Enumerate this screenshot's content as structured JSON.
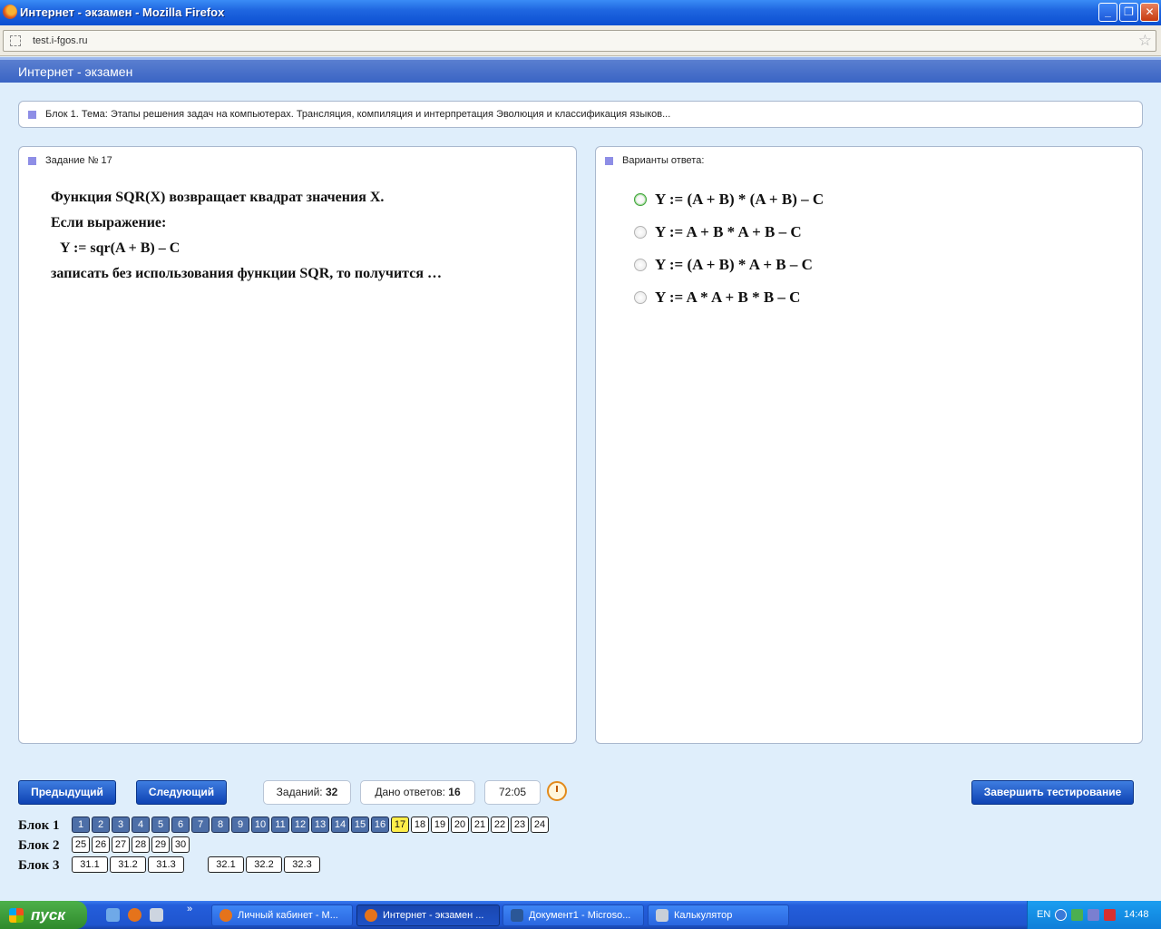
{
  "window": {
    "title": "Интернет - экзамен - Mozilla Firefox",
    "url": "test.i-fgos.ru"
  },
  "app": {
    "header_title": "Интернет - экзамен"
  },
  "block_info": "Блок 1. Тема: Этапы решения задач на компьютерах. Трансляция, компиляция и интерпретация Эволюция и классификация языков...",
  "task": {
    "header": "Задание № 17",
    "lines": [
      "Функция SQR(X) возвращает квадрат значения X.",
      "Если выражение:",
      "Y := sqr(A + B) – C",
      "записать без использования функции SQR, то получится …"
    ]
  },
  "answers": {
    "header": "Варианты ответа:",
    "options": [
      "Y := (A + B) * (A + B) – C",
      "Y := A + B * A + B – C",
      "Y := (A + B) * A + B – C",
      "Y := A * A + B * B – C"
    ]
  },
  "controls": {
    "prev": "Предыдущий",
    "next": "Следующий",
    "tasks_label": "Заданий:",
    "tasks_value": "32",
    "answered_label": "Дано ответов:",
    "answered_value": "16",
    "timer": "72:05",
    "finish": "Завершить тестирование"
  },
  "blocks": [
    {
      "label": "Блок 1",
      "items": [
        "1",
        "2",
        "3",
        "4",
        "5",
        "6",
        "7",
        "8",
        "9",
        "10",
        "11",
        "12",
        "13",
        "14",
        "15",
        "16",
        "17",
        "18",
        "19",
        "20",
        "21",
        "22",
        "23",
        "24"
      ]
    },
    {
      "label": "Блок 2",
      "items": [
        "25",
        "26",
        "27",
        "28",
        "29",
        "30"
      ]
    },
    {
      "label": "Блок 3",
      "items": [
        "31.1",
        "31.2",
        "31.3",
        "32.1",
        "32.2",
        "32.3"
      ]
    }
  ],
  "answered_questions": [
    "1",
    "2",
    "3",
    "4",
    "5",
    "6",
    "7",
    "8",
    "9",
    "10",
    "11",
    "12",
    "13",
    "14",
    "15",
    "16"
  ],
  "current_question": "17",
  "taskbar": {
    "start": "пуск",
    "windows": [
      "Личный кабинет - М...",
      "Интернет - экзамен ...",
      "Документ1 - Microso...",
      "Калькулятор"
    ],
    "lang": "EN",
    "clock": "14:48"
  }
}
